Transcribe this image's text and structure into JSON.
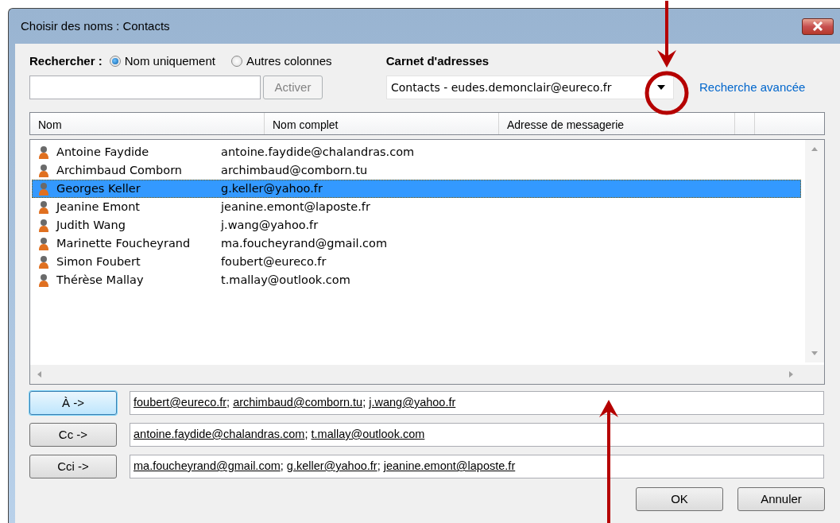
{
  "window": {
    "title": "Choisir des noms : Contacts"
  },
  "search": {
    "label": "Rechercher :",
    "options": [
      {
        "label": "Nom uniquement",
        "selected": true
      },
      {
        "label": "Autres colonnes",
        "selected": false
      }
    ],
    "button": {
      "label": "Activer",
      "disabled": true
    }
  },
  "address_book": {
    "label": "Carnet d'adresses",
    "value": "Contacts - eudes.demonclair@eureco.fr",
    "link": "Recherche avancée"
  },
  "table": {
    "columns": [
      "Nom",
      "Nom complet",
      "Adresse de messagerie"
    ],
    "rows": [
      {
        "name": "Antoine Faydide",
        "email": "antoine.faydide@chalandras.com",
        "selected": false
      },
      {
        "name": "Archimbaud Comborn",
        "email": "archimbaud@comborn.tu",
        "selected": false
      },
      {
        "name": "Georges Keller",
        "email": "g.keller@yahoo.fr",
        "selected": true
      },
      {
        "name": "Jeanine Emont",
        "email": "jeanine.emont@laposte.fr",
        "selected": false
      },
      {
        "name": "Judith Wang",
        "email": "j.wang@yahoo.fr",
        "selected": false
      },
      {
        "name": "Marinette Foucheyrand",
        "email": "ma.foucheyrand@gmail.com",
        "selected": false
      },
      {
        "name": "Simon Foubert",
        "email": "foubert@eureco.fr",
        "selected": false
      },
      {
        "name": "Thérèse Mallay",
        "email": "t.mallay@outlook.com",
        "selected": false
      }
    ]
  },
  "recipients": [
    {
      "button": "À ->",
      "focused": true,
      "separator": ";",
      "addresses": [
        "foubert@eureco.fr",
        "archimbaud@comborn.tu",
        "j.wang@yahoo.fr"
      ]
    },
    {
      "button": "Cc ->",
      "focused": false,
      "separator": ";",
      "addresses": [
        "antoine.faydide@chalandras.com",
        "t.mallay@outlook.com"
      ]
    },
    {
      "button": "Cci ->",
      "focused": false,
      "separator": ";",
      "addresses": [
        "ma.foucheyrand@gmail.com",
        "g.keller@yahoo.fr",
        "jeanine.emont@laposte.fr"
      ]
    }
  ],
  "buttons": [
    "OK",
    "Annuler"
  ]
}
